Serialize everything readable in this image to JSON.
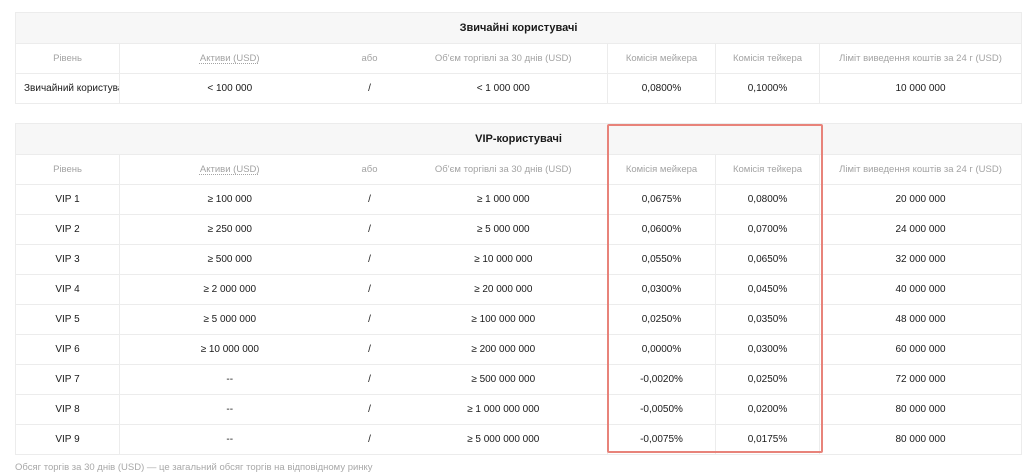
{
  "regular": {
    "title": "Звичайні користувачі",
    "headers": {
      "level": "Рівень",
      "assets": "Активи (USD)",
      "or": "або",
      "volume": "Об'єм торгівлі за 30 днів (USD)",
      "maker": "Комісія мейкера",
      "taker": "Комісія тейкера",
      "limit": "Ліміт виведення коштів за 24 г (USD)"
    },
    "rows": [
      {
        "level": "Звичайний користувач",
        "assets": "< 100 000",
        "or": "/",
        "volume": "< 1 000 000",
        "maker": "0,0800%",
        "taker": "0,1000%",
        "limit": "10 000 000"
      }
    ]
  },
  "vip": {
    "title": "VIP-користувачі",
    "headers": {
      "level": "Рівень",
      "assets": "Активи (USD)",
      "or": "або",
      "volume": "Об'єм торгівлі за 30 днів (USD)",
      "maker": "Комісія мейкера",
      "taker": "Комісія тейкера",
      "limit": "Ліміт виведення коштів за 24 г (USD)"
    },
    "rows": [
      {
        "level": "VIP 1",
        "assets": "≥ 100 000",
        "or": "/",
        "volume": "≥ 1 000 000",
        "maker": "0,0675%",
        "taker": "0,0800%",
        "limit": "20 000 000"
      },
      {
        "level": "VIP 2",
        "assets": "≥ 250 000",
        "or": "/",
        "volume": "≥ 5 000 000",
        "maker": "0,0600%",
        "taker": "0,0700%",
        "limit": "24 000 000"
      },
      {
        "level": "VIP 3",
        "assets": "≥ 500 000",
        "or": "/",
        "volume": "≥ 10 000 000",
        "maker": "0,0550%",
        "taker": "0,0650%",
        "limit": "32 000 000"
      },
      {
        "level": "VIP 4",
        "assets": "≥ 2 000 000",
        "or": "/",
        "volume": "≥ 20 000 000",
        "maker": "0,0300%",
        "taker": "0,0450%",
        "limit": "40 000 000"
      },
      {
        "level": "VIP 5",
        "assets": "≥ 5 000 000",
        "or": "/",
        "volume": "≥ 100 000 000",
        "maker": "0,0250%",
        "taker": "0,0350%",
        "limit": "48 000 000"
      },
      {
        "level": "VIP 6",
        "assets": "≥ 10 000 000",
        "or": "/",
        "volume": "≥ 200 000 000",
        "maker": "0,0000%",
        "taker": "0,0300%",
        "limit": "60 000 000"
      },
      {
        "level": "VIP 7",
        "assets": "--",
        "or": "/",
        "volume": "≥ 500 000 000",
        "maker": "-0,0020%",
        "taker": "0,0250%",
        "limit": "72 000 000"
      },
      {
        "level": "VIP 8",
        "assets": "--",
        "or": "/",
        "volume": "≥ 1 000 000 000",
        "maker": "-0,0050%",
        "taker": "0,0200%",
        "limit": "80 000 000"
      },
      {
        "level": "VIP 9",
        "assets": "--",
        "or": "/",
        "volume": "≥ 5 000 000 000",
        "maker": "-0,0075%",
        "taker": "0,0175%",
        "limit": "80 000 000"
      }
    ]
  },
  "footnote": "Обсяг торгів за 30 днів (USD) — це загальний обсяг торгів на відповідному ринку",
  "colors": {
    "highlight": "#e8837a",
    "header_bg": "#f7f7f7"
  }
}
